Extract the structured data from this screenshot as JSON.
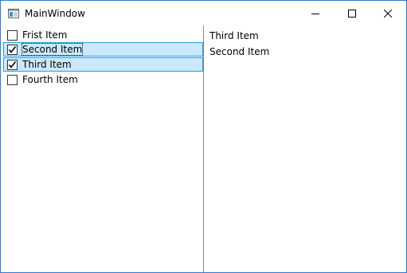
{
  "window": {
    "title": "MainWindow",
    "icon": "app-window-icon",
    "controls": [
      "minimize-icon",
      "maximize-icon",
      "close-icon"
    ]
  },
  "left_list": {
    "items": [
      {
        "label": "Frist Item",
        "checked": false,
        "selected": false
      },
      {
        "label": "Second Item",
        "checked": true,
        "selected": true,
        "focused": true
      },
      {
        "label": "Third Item",
        "checked": true,
        "selected": true
      },
      {
        "label": "Fourth Item",
        "checked": false,
        "selected": false
      }
    ]
  },
  "right_list": {
    "items": [
      "Third Item",
      "Second Item"
    ]
  },
  "colors": {
    "selection_background": "#cce8ff",
    "selection_border": "#26a0da",
    "window_border": "#2b7bd6"
  }
}
